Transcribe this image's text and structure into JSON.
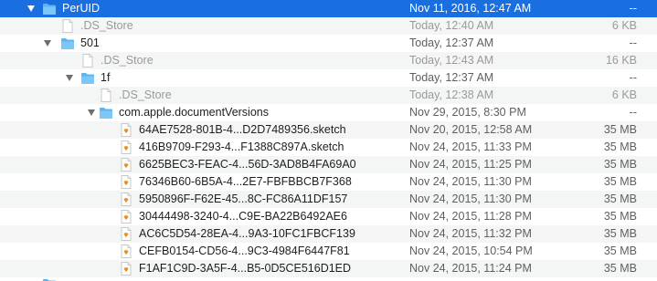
{
  "rows": [
    {
      "name": "PerUID",
      "date": "Nov 11, 2016, 12:47 AM",
      "size": "--",
      "kind": "folder",
      "expanded": true,
      "selected": true,
      "dim": false,
      "depth": 0
    },
    {
      "name": ".DS_Store",
      "date": "Today, 12:40 AM",
      "size": "6 KB",
      "kind": "file",
      "selected": false,
      "dim": true,
      "depth": 1
    },
    {
      "name": "501",
      "date": "Today, 12:37 AM",
      "size": "--",
      "kind": "folder",
      "expanded": true,
      "selected": false,
      "dim": false,
      "depth": 1
    },
    {
      "name": ".DS_Store",
      "date": "Today, 12:43 AM",
      "size": "16 KB",
      "kind": "file",
      "selected": false,
      "dim": true,
      "depth": 2
    },
    {
      "name": "1f",
      "date": "Today, 12:37 AM",
      "size": "--",
      "kind": "folder",
      "expanded": true,
      "selected": false,
      "dim": false,
      "depth": 2
    },
    {
      "name": ".DS_Store",
      "date": "Today, 12:38 AM",
      "size": "6 KB",
      "kind": "file",
      "selected": false,
      "dim": true,
      "depth": 3
    },
    {
      "name": "com.apple.documentVersions",
      "date": "Nov 29, 2015, 8:30 PM",
      "size": "--",
      "kind": "folder",
      "expanded": true,
      "selected": false,
      "dim": false,
      "depth": 3
    },
    {
      "name": "64AE7528-801B-4...D2D7489356.sketch",
      "date": "Nov 20, 2015, 12:58 AM",
      "size": "35 MB",
      "kind": "sketch",
      "selected": false,
      "dim": false,
      "depth": 4
    },
    {
      "name": "416B9709-F293-4...F1388C897A.sketch",
      "date": "Nov 24, 2015, 11:33 PM",
      "size": "35 MB",
      "kind": "sketch",
      "selected": false,
      "dim": false,
      "depth": 4
    },
    {
      "name": "6625BEC3-FEAC-4...56D-3AD8B4FA69A0",
      "date": "Nov 24, 2015, 11:25 PM",
      "size": "35 MB",
      "kind": "sketch",
      "selected": false,
      "dim": false,
      "depth": 4
    },
    {
      "name": "76346B60-6B5A-4...2E7-FBFBBCB7F368",
      "date": "Nov 24, 2015, 11:30 PM",
      "size": "35 MB",
      "kind": "sketch",
      "selected": false,
      "dim": false,
      "depth": 4
    },
    {
      "name": "5950896F-F62E-45...8C-FC86A11DF157",
      "date": "Nov 24, 2015, 11:30 PM",
      "size": "35 MB",
      "kind": "sketch",
      "selected": false,
      "dim": false,
      "depth": 4
    },
    {
      "name": "30444498-3240-4...C9E-BA22B6492AE6",
      "date": "Nov 24, 2015, 11:28 PM",
      "size": "35 MB",
      "kind": "sketch",
      "selected": false,
      "dim": false,
      "depth": 4
    },
    {
      "name": "AC6C5D54-28EA-4...9A3-10FC1FBCF139",
      "date": "Nov 24, 2015, 11:32 PM",
      "size": "35 MB",
      "kind": "sketch",
      "selected": false,
      "dim": false,
      "depth": 4
    },
    {
      "name": "CEFB0154-CD56-4...9C3-4984F6447F81",
      "date": "Nov 24, 2015, 10:54 PM",
      "size": "35 MB",
      "kind": "sketch",
      "selected": false,
      "dim": false,
      "depth": 4
    },
    {
      "name": "F1AF1C9D-3A5F-4...B5-0D5CE516D1ED",
      "date": "Nov 24, 2015, 11:24 PM",
      "size": "35 MB",
      "kind": "sketch",
      "selected": false,
      "dim": false,
      "depth": 4
    },
    {
      "name": "",
      "date": "",
      "size": "",
      "kind": "folder",
      "expanded": false,
      "selected": false,
      "dim": false,
      "depth": 0,
      "partial": true
    }
  ],
  "colors": {
    "selection": "#1a6fe0",
    "folder": "#5db3f2",
    "stripe": "#f4f5f5",
    "sketch_diamond": "#f7a42a"
  },
  "icons": {
    "disclosure": "disclosure-triangle-icon",
    "folder": "folder-icon",
    "file": "document-icon",
    "sketch": "sketch-document-icon"
  }
}
